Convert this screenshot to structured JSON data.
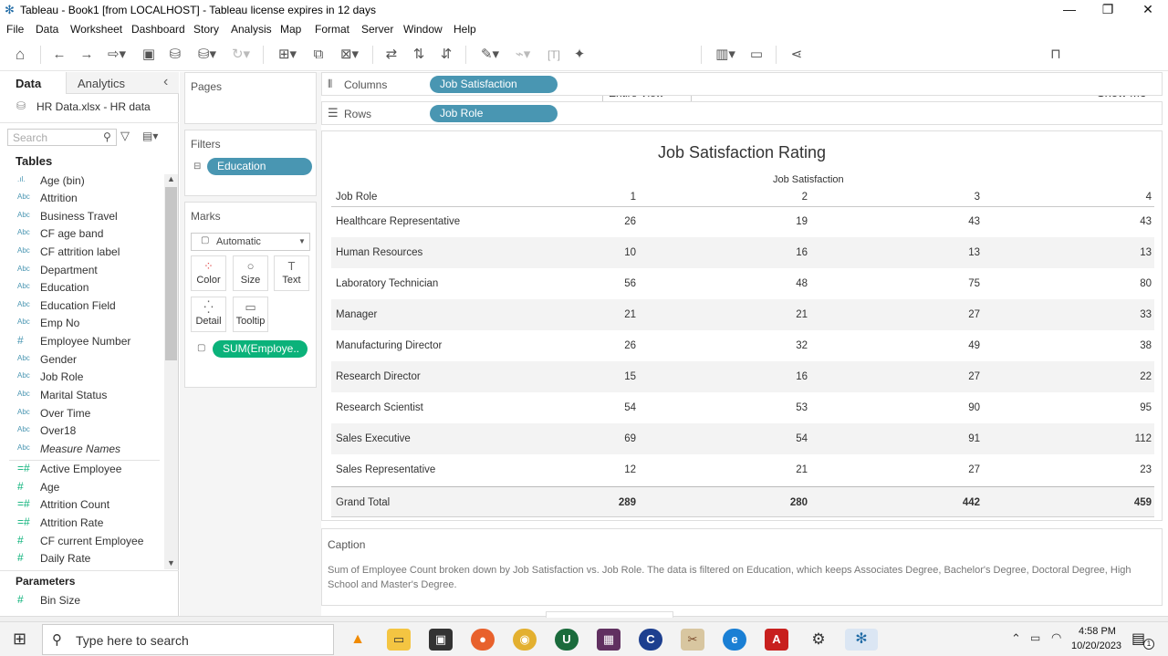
{
  "window": {
    "title": "Tableau - Book1 [from LOCALHOST] - Tableau license expires in 12 days",
    "controls": [
      "—",
      "❐",
      "✕"
    ]
  },
  "menu": [
    "File",
    "Data",
    "Worksheet",
    "Dashboard",
    "Story",
    "Analysis",
    "Map",
    "Format",
    "Server",
    "Window",
    "Help"
  ],
  "toolbar": {
    "view_select": "Entire View",
    "show_me": "Show Me"
  },
  "data_pane": {
    "tab_data": "Data",
    "tab_analytics": "Analytics",
    "collapse": "‹",
    "datasource": "HR Data.xlsx - HR data",
    "search_placeholder": "Search",
    "tables_heading": "Tables",
    "dimensions": [
      {
        "icon": ".ıl.",
        "label": "Age (bin)"
      },
      {
        "icon": "Abc",
        "label": "Attrition"
      },
      {
        "icon": "Abc",
        "label": "Business Travel"
      },
      {
        "icon": "Abc",
        "label": "CF age band"
      },
      {
        "icon": "Abc",
        "label": "CF attrition label"
      },
      {
        "icon": "Abc",
        "label": "Department"
      },
      {
        "icon": "Abc",
        "label": "Education"
      },
      {
        "icon": "Abc",
        "label": "Education Field"
      },
      {
        "icon": "Abc",
        "label": "Emp No"
      },
      {
        "icon": "#",
        "label": "Employee Number"
      },
      {
        "icon": "Abc",
        "label": "Gender"
      },
      {
        "icon": "Abc",
        "label": "Job Role"
      },
      {
        "icon": "Abc",
        "label": "Marital Status"
      },
      {
        "icon": "Abc",
        "label": "Over Time"
      },
      {
        "icon": "Abc",
        "label": "Over18"
      },
      {
        "icon": "Abc",
        "label": "Measure Names"
      }
    ],
    "measures": [
      {
        "icon": "=#",
        "label": "Active Employee"
      },
      {
        "icon": "#",
        "label": "Age"
      },
      {
        "icon": "=#",
        "label": "Attrition Count"
      },
      {
        "icon": "=#",
        "label": "Attrition Rate"
      },
      {
        "icon": "#",
        "label": "CF current Employee"
      },
      {
        "icon": "#",
        "label": "Daily Rate"
      }
    ],
    "parameters_heading": "Parameters",
    "parameters": [
      {
        "icon": "#",
        "label": "Bin Size"
      }
    ]
  },
  "cards": {
    "pages": "Pages",
    "filters": "Filters",
    "filter_pill": "Education",
    "marks": "Marks",
    "mark_type": "Automatic",
    "mark_buttons": [
      {
        "icon": "⁘",
        "label": "Color"
      },
      {
        "icon": "○",
        "label": "Size"
      },
      {
        "icon": "T",
        "label": "Text"
      },
      {
        "icon": "⁛",
        "label": "Detail"
      },
      {
        "icon": "▭",
        "label": "Tooltip"
      }
    ],
    "text_pill": "SUM(Employe.."
  },
  "shelves": {
    "columns_label": "Columns",
    "columns_pill": "Job Satisfaction",
    "rows_label": "Rows",
    "rows_pill": "Job Role"
  },
  "view": {
    "title": "Job Satisfaction Rating",
    "column_header": "Job Satisfaction",
    "row_header": "Job Role",
    "columns": [
      "1",
      "2",
      "3",
      "4"
    ],
    "rows": [
      {
        "label": "Healthcare Representative",
        "values": [
          "26",
          "19",
          "43",
          "43"
        ]
      },
      {
        "label": "Human Resources",
        "values": [
          "10",
          "16",
          "13",
          "13"
        ]
      },
      {
        "label": "Laboratory Technician",
        "values": [
          "56",
          "48",
          "75",
          "80"
        ]
      },
      {
        "label": "Manager",
        "values": [
          "21",
          "21",
          "27",
          "33"
        ]
      },
      {
        "label": "Manufacturing Director",
        "values": [
          "26",
          "32",
          "49",
          "38"
        ]
      },
      {
        "label": "Research Director",
        "values": [
          "15",
          "16",
          "27",
          "22"
        ]
      },
      {
        "label": "Research Scientist",
        "values": [
          "54",
          "53",
          "90",
          "95"
        ]
      },
      {
        "label": "Sales Executive",
        "values": [
          "69",
          "54",
          "91",
          "112"
        ]
      },
      {
        "label": "Sales Representative",
        "values": [
          "12",
          "21",
          "27",
          "23"
        ]
      }
    ],
    "total": {
      "label": "Grand Total",
      "values": [
        "289",
        "280",
        "442",
        "459"
      ]
    }
  },
  "caption": {
    "heading": "Caption",
    "text": "Sum of Employee Count broken down by Job Satisfaction vs. Job Role. The data is filtered on Education, which keeps Associates Degree, Bachelor's Degree, Doctoral Degree, High School and Master's Degree."
  },
  "taskbar": {
    "search_placeholder": "Type here to search",
    "time": "4:58 PM",
    "date": "10/20/2023",
    "notification_count": "1"
  },
  "colors": {
    "pill_blue": "#4996b2",
    "pill_green": "#0bb27a"
  }
}
